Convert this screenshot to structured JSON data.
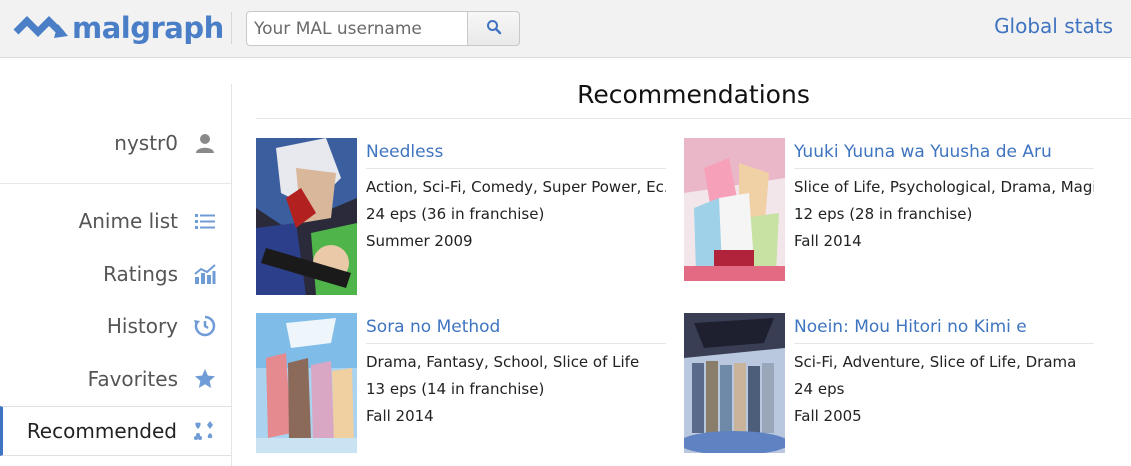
{
  "header": {
    "logo_text": "malgraph",
    "search": {
      "placeholder": "Your MAL username",
      "value": ""
    },
    "global_stats_label": "Global stats"
  },
  "sidebar": {
    "username": "nystr0",
    "items": [
      {
        "label": "Anime list",
        "icon": "list-icon"
      },
      {
        "label": "Ratings",
        "icon": "bar-chart-icon"
      },
      {
        "label": "History",
        "icon": "history-icon"
      },
      {
        "label": "Favorites",
        "icon": "star-icon"
      },
      {
        "label": "Recommended",
        "icon": "suits-icon",
        "active": true
      }
    ]
  },
  "main": {
    "title": "Recommendations",
    "recommendations": [
      {
        "title": "Needless",
        "genres": "Action, Sci-Fi, Comedy, Super Power, Ec...",
        "episodes": "24 eps (36 in franchise)",
        "season": "Summer 2009"
      },
      {
        "title": "Yuuki Yuuna wa Yuusha de Aru",
        "genres": "Slice of Life, Psychological, Drama, Magi...",
        "episodes": "12 eps (28 in franchise)",
        "season": "Fall 2014"
      },
      {
        "title": "Sora no Method",
        "genres": "Drama, Fantasy, School, Slice of Life",
        "episodes": "13 eps (14 in franchise)",
        "season": "Fall 2014"
      },
      {
        "title": "Noein: Mou Hitori no Kimi e",
        "genres": "Sci-Fi, Adventure, Slice of Life, Drama",
        "episodes": "24 eps",
        "season": "Fall 2005"
      }
    ]
  },
  "colors": {
    "accent": "#3f74c0",
    "header_bg": "#f2f2f2",
    "icon_blue": "#6f9bd6"
  }
}
